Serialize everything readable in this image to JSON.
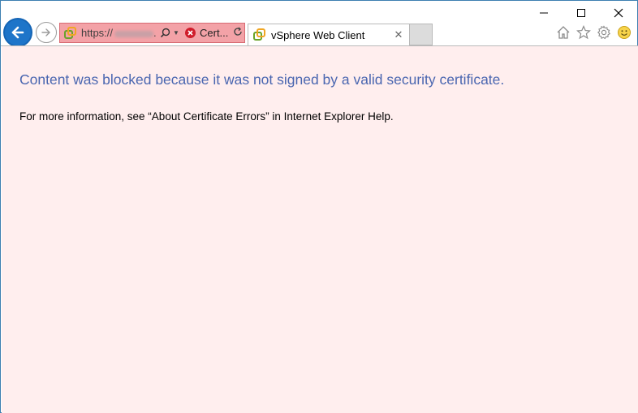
{
  "window": {
    "controls": {
      "minimize": "–",
      "maximize": "☐",
      "close": "✕"
    }
  },
  "nav": {
    "back_icon": "back-arrow-icon",
    "forward_icon": "forward-arrow-icon"
  },
  "address_bar": {
    "url_prefix": "https://",
    "url_suffix": ".",
    "certificate_label": "Cert...",
    "background_color": "#f3a2a7"
  },
  "tab": {
    "title": "vSphere Web Client",
    "close": "✕"
  },
  "content": {
    "headline": "Content was blocked because it was not signed by a valid security certificate.",
    "info": "For more information, see “About Certificate Errors” in Internet Explorer Help.",
    "background_color": "#ffeeee",
    "headline_color": "#4a66b0"
  }
}
